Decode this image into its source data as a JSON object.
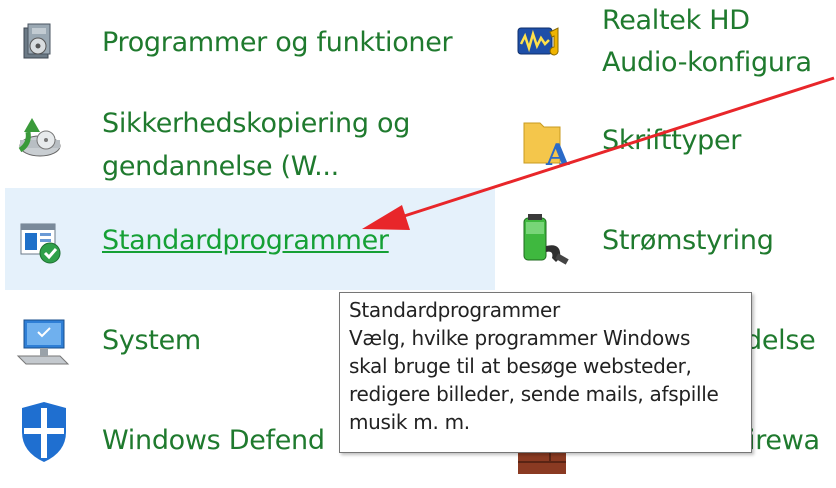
{
  "items": {
    "programmer": {
      "label": "Programmer og funktioner",
      "icon": "programs-icon"
    },
    "realtek_line1": "Realtek HD",
    "realtek_line2": "Audio-konfigura",
    "backup_line1": "Sikkerhedskopiering og",
    "backup_line2": "gendannelse (W...",
    "fonts": "Skrifttyper",
    "default_programs": "Standardprogrammer",
    "power": "Strømstyring",
    "system": "System",
    "partial_right": "delse",
    "defender": "Windows Defend",
    "firewall_partial": "irewa"
  },
  "tooltip": {
    "title": "Standardprogrammer",
    "line1": "Vælg, hvilke programmer Windows",
    "line2": "skal bruge til at besøge websteder,",
    "line3": "redigere billeder, sende mails, afspille",
    "line4": "musik m. m."
  },
  "colors": {
    "link": "#1f7a2e",
    "hover_bg": "#e5f1fb",
    "arrow": "#e8262a"
  }
}
